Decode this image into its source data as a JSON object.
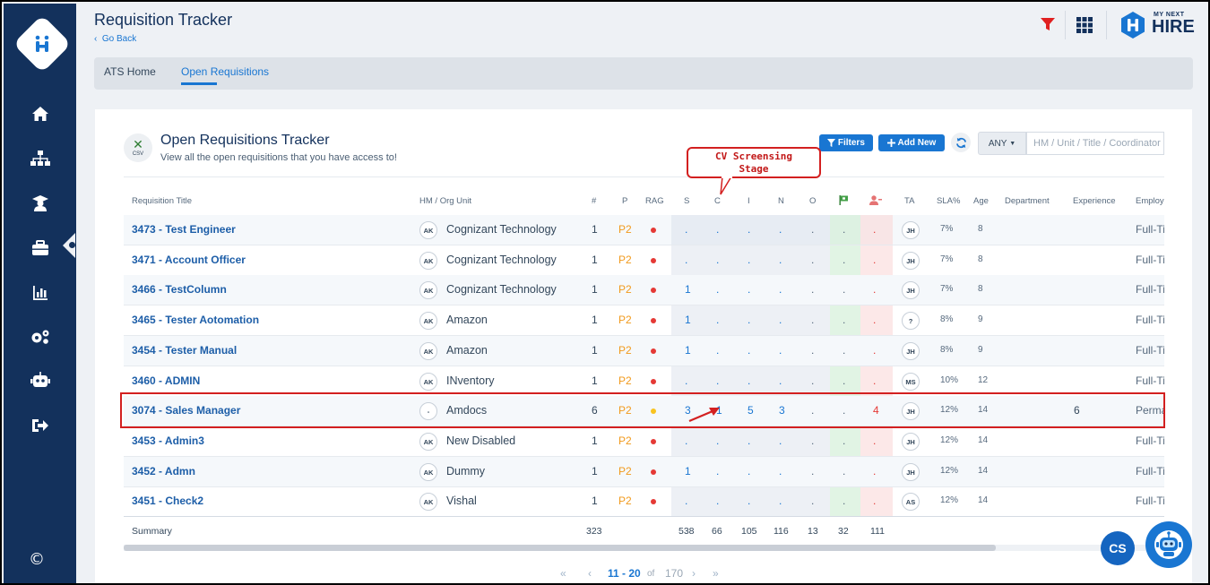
{
  "header": {
    "title": "Requisition Tracker",
    "go_back": "Go Back",
    "brand_top": "MY NEXT",
    "brand_bottom": "HIRE"
  },
  "tabs": [
    {
      "label": "ATS Home",
      "active": false
    },
    {
      "label": "Open Requisitions",
      "active": true
    }
  ],
  "panel": {
    "csv_label": "CSV",
    "title": "Open Requisitions Tracker",
    "subtitle": "View all the open requisitions that you have access to!",
    "filters_label": "Filters",
    "add_new_label": "Add New",
    "scope_select": "ANY",
    "search_placeholder": "HM / Unit / Title / Coordinator"
  },
  "callout": {
    "line1": "CV Screensing",
    "line2": "Stage"
  },
  "columns": {
    "title": "Requisition Title",
    "hm_unit": "HM / Org Unit",
    "count": "#",
    "priority": "P",
    "rag": "RAG",
    "s": "S",
    "c": "C",
    "i": "I",
    "n": "N",
    "o": "O",
    "ta": "TA",
    "sla": "SLA%",
    "age": "Age",
    "department": "Department",
    "experience": "Experience",
    "employment": "Employment"
  },
  "rows": [
    {
      "title": "3473 - Test Engineer",
      "hm": "AK",
      "unit": "Cognizant Technology",
      "count": "1",
      "priority": "P2",
      "rag": "#e53935",
      "s": ".",
      "c": ".",
      "i": ".",
      "n": ".",
      "o": ".",
      "joined": ".",
      "rejected": ".",
      "ta": "JH",
      "sla": "7%",
      "age": "8",
      "experience": "",
      "employment": "Full-Time"
    },
    {
      "title": "3471 - Account Officer",
      "hm": "AK",
      "unit": "Cognizant Technology",
      "count": "1",
      "priority": "P2",
      "rag": "#e53935",
      "s": ".",
      "c": ".",
      "i": ".",
      "n": ".",
      "o": ".",
      "joined": ".",
      "rejected": ".",
      "ta": "JH",
      "sla": "7%",
      "age": "8",
      "experience": "",
      "employment": "Full-Time"
    },
    {
      "title": "3466 - TestColumn",
      "hm": "AK",
      "unit": "Cognizant Technology",
      "count": "1",
      "priority": "P2",
      "rag": "#e53935",
      "s": "1",
      "c": ".",
      "i": ".",
      "n": ".",
      "o": ".",
      "joined": ".",
      "rejected": ".",
      "ta": "JH",
      "sla": "7%",
      "age": "8",
      "experience": "",
      "employment": "Full-Time"
    },
    {
      "title": "3465 - Tester Aotomation",
      "hm": "AK",
      "unit": "Amazon",
      "count": "1",
      "priority": "P2",
      "rag": "#e53935",
      "s": "1",
      "c": ".",
      "i": ".",
      "n": ".",
      "o": ".",
      "joined": ".",
      "rejected": ".",
      "ta": "?",
      "sla": "8%",
      "age": "9",
      "experience": "",
      "employment": "Full-Time"
    },
    {
      "title": "3454 - Tester Manual",
      "hm": "AK",
      "unit": "Amazon",
      "count": "1",
      "priority": "P2",
      "rag": "#e53935",
      "s": "1",
      "c": ".",
      "i": ".",
      "n": ".",
      "o": ".",
      "joined": ".",
      "rejected": ".",
      "ta": "JH",
      "sla": "8%",
      "age": "9",
      "experience": "",
      "employment": "Full-Time"
    },
    {
      "title": "3460 - ADMIN",
      "hm": "AK",
      "unit": "INventory",
      "count": "1",
      "priority": "P2",
      "rag": "#e53935",
      "s": ".",
      "c": ".",
      "i": ".",
      "n": ".",
      "o": ".",
      "joined": ".",
      "rejected": ".",
      "ta": "MS",
      "sla": "10%",
      "age": "12",
      "experience": "",
      "employment": "Full-Time"
    },
    {
      "title": "3074 - Sales Manager",
      "hm": "-",
      "unit": "Amdocs",
      "count": "6",
      "priority": "P2",
      "rag": "#f9c31f",
      "s": "3",
      "c": "1",
      "i": "5",
      "n": "3",
      "o": ".",
      "joined": ".",
      "rejected": "4",
      "ta": "JH",
      "sla": "12%",
      "age": "14",
      "experience": "6",
      "employment": "Permanent"
    },
    {
      "title": "3453 - Admin3",
      "hm": "AK",
      "unit": "New Disabled",
      "count": "1",
      "priority": "P2",
      "rag": "#e53935",
      "s": ".",
      "c": ".",
      "i": ".",
      "n": ".",
      "o": ".",
      "joined": ".",
      "rejected": ".",
      "ta": "JH",
      "sla": "12%",
      "age": "14",
      "experience": "",
      "employment": "Full-Time"
    },
    {
      "title": "3452 - Admn",
      "hm": "AK",
      "unit": "Dummy",
      "count": "1",
      "priority": "P2",
      "rag": "#e53935",
      "s": "1",
      "c": ".",
      "i": ".",
      "n": ".",
      "o": ".",
      "joined": ".",
      "rejected": ".",
      "ta": "JH",
      "sla": "12%",
      "age": "14",
      "experience": "",
      "employment": "Full-Time"
    },
    {
      "title": "3451 - Check2",
      "hm": "AK",
      "unit": "Vishal",
      "count": "1",
      "priority": "P2",
      "rag": "#e53935",
      "s": ".",
      "c": ".",
      "i": ".",
      "n": ".",
      "o": ".",
      "joined": ".",
      "rejected": ".",
      "ta": "AS",
      "sla": "12%",
      "age": "14",
      "experience": "",
      "employment": "Full-Time"
    }
  ],
  "summary": {
    "label": "Summary",
    "count": "323",
    "s": "538",
    "c": "66",
    "i": "105",
    "n": "116",
    "o": "13",
    "joined": "32",
    "rejected": "111"
  },
  "pagination": {
    "range": "11 - 20",
    "of": "of",
    "total": "170"
  },
  "fab": {
    "cs": "CS"
  },
  "colors": {
    "sidebar": "#13315c",
    "accent": "#1976d2",
    "priority": "#f19a1d",
    "rag_red": "#e53935",
    "rag_amber": "#f9c31f",
    "highlight": "#d32020"
  }
}
